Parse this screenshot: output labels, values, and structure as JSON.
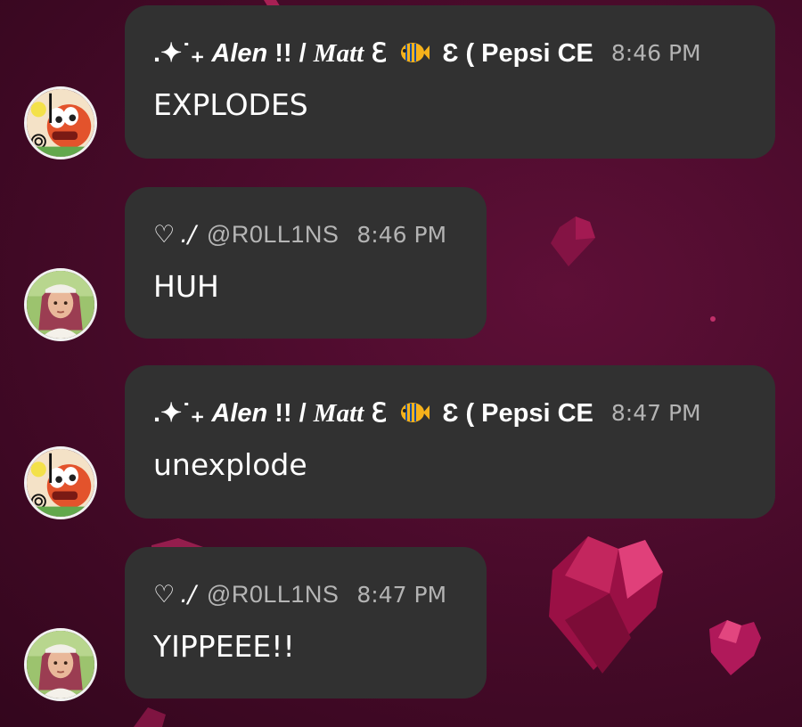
{
  "messages": [
    {
      "author_style": "alen",
      "name_prefix": ".✦˙₊",
      "name_main": "Alen",
      "name_mid": "!! /",
      "name_matt": "Matt",
      "name_mid2": "ℇ",
      "name_tail": "Ɛ ( Pepsi CE",
      "time": "8:46 PM",
      "text": "EXPLODES"
    },
    {
      "author_style": "rollins",
      "heart": "♡",
      "slash": "./",
      "username": "@R0LL1NS",
      "time": "8:46 PM",
      "text": "HUH"
    },
    {
      "author_style": "alen",
      "name_prefix": ".✦˙₊",
      "name_main": "Alen",
      "name_mid": "!! /",
      "name_matt": "Matt",
      "name_mid2": "ℇ",
      "name_tail": "Ɛ ( Pepsi CE",
      "time": "8:47 PM",
      "text": "unexplode"
    },
    {
      "author_style": "rollins",
      "heart": "♡",
      "slash": "./",
      "username": "@R0LL1NS",
      "time": "8:47 PM",
      "text": "YIPPEEE!!"
    }
  ],
  "colors": {
    "bubble": "#313131",
    "background": "#4a0b2b",
    "heart_accent": "#d4185a",
    "timestamp": "#b3b3b3"
  },
  "icons": {
    "fish": "tropical-fish-emoji",
    "hearts": "polygon-heart-decoration"
  }
}
